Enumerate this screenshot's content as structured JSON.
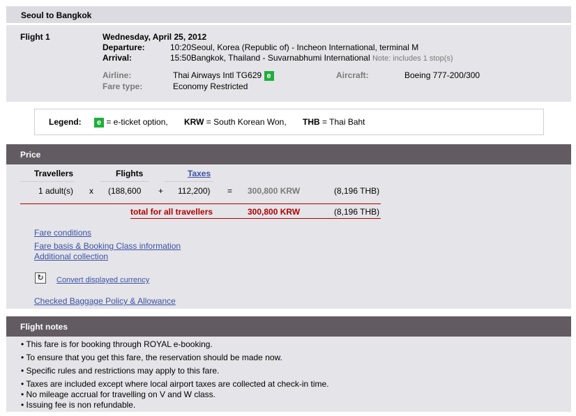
{
  "route": {
    "title": "Seoul to Bangkok"
  },
  "flight": {
    "label": "Flight 1",
    "date": "Wednesday, April 25, 2012",
    "departure_label": "Departure:",
    "departure_time": "10:20",
    "departure_place": "Seoul, Korea (Republic of) - Incheon International, terminal M",
    "arrival_label": "Arrival:",
    "arrival_time": "15:50",
    "arrival_place": "Bangkok, Thailand - Suvarnabhumi International",
    "arrival_note": "Note: includes 1 stop(s)",
    "airline_label": "Airline:",
    "airline_value": "Thai Airways Intl TG629",
    "eticket_icon_text": "e",
    "aircraft_label": "Aircraft:",
    "aircraft_value": "Boeing 777-200/300",
    "fare_type_label": "Fare type:",
    "fare_type_value": "Economy Restricted"
  },
  "legend": {
    "label": "Legend:",
    "e_icon": "e",
    "e_text": "= e-ticket option,",
    "krw_code": "KRW",
    "krw_text": "= South Korean Won,",
    "thb_code": "THB",
    "thb_text": "= Thai Baht"
  },
  "price": {
    "header": "Price",
    "col_travellers": "Travellers",
    "col_flights": "Flights",
    "col_taxes": "Taxes",
    "row_travellers": "1 adult(s)",
    "times": "x",
    "row_flights": "(188,600",
    "plus": "+",
    "row_taxes": "112,200)",
    "equals": "=",
    "row_total_krw": "300,800 KRW",
    "row_total_thb": "(8,196 THB)",
    "total_label": "total for all travellers",
    "total_krw": "300,800 KRW",
    "total_thb": "(8,196 THB)"
  },
  "links": {
    "fare_conditions": "Fare conditions",
    "fare_basis": "Fare basis & Booking Class information",
    "additional_collection": "Additional collection",
    "convert_currency": "Convert displayed currency",
    "baggage_policy": "Checked Baggage Policy & Allowance"
  },
  "notes": {
    "header": "Flight notes",
    "items": [
      "• This fare is for booking through ROYAL e-booking.",
      "• To ensure that you get this fare, the reservation should be made now.",
      "• Specific rules and restrictions may apply to this fare.",
      "• Taxes are included except where local airport taxes are collected at check-in time.",
      "• No mileage accrual for travelling on V and W class.",
      "• Issuing fee is non refundable."
    ]
  },
  "colors": {
    "section_header_bg": "#625b61",
    "panel_bg": "#e5e4e8",
    "eticket_green": "#1fae3c",
    "total_red": "#b00000",
    "link_blue": "#3a52a8"
  }
}
